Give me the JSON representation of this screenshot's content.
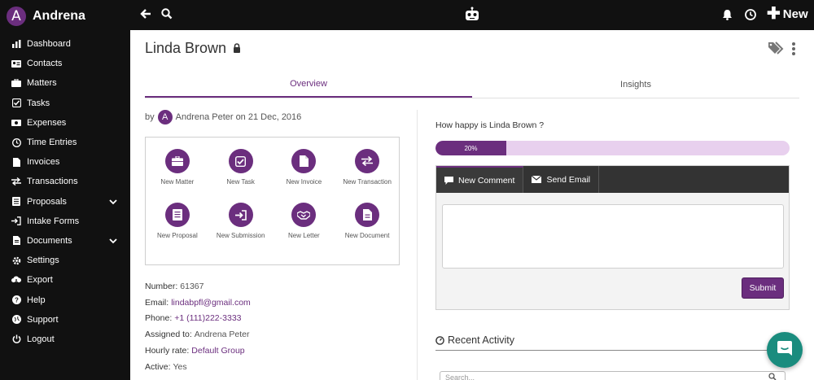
{
  "brand": {
    "initial": "A",
    "name": "Andrena"
  },
  "sidebar": {
    "items": [
      {
        "label": "Dashboard",
        "icon": "bar-chart-icon"
      },
      {
        "label": "Contacts",
        "icon": "id-card-icon"
      },
      {
        "label": "Matters",
        "icon": "briefcase-icon"
      },
      {
        "label": "Tasks",
        "icon": "checkbox-icon"
      },
      {
        "label": "Expenses",
        "icon": "money-icon"
      },
      {
        "label": "Time Entries",
        "icon": "clock-icon"
      },
      {
        "label": "Invoices",
        "icon": "file-icon"
      },
      {
        "label": "Transactions",
        "icon": "exchange-icon"
      },
      {
        "label": "Proposals",
        "icon": "list-icon",
        "has_submenu": true
      },
      {
        "label": "Intake Forms",
        "icon": "sign-in-icon"
      },
      {
        "label": "Documents",
        "icon": "document-icon",
        "has_submenu": true
      },
      {
        "label": "Settings",
        "icon": "gear-icon"
      },
      {
        "label": "Export",
        "icon": "cloud-download-icon"
      },
      {
        "label": "Help",
        "icon": "question-icon"
      },
      {
        "label": "Support",
        "icon": "globe-icon"
      },
      {
        "label": "Logout",
        "icon": "power-icon"
      }
    ]
  },
  "topbar": {
    "new_label": "New"
  },
  "contact": {
    "name": "Linda Brown",
    "tabs": [
      {
        "label": "Overview",
        "active": true
      },
      {
        "label": "Insights",
        "active": false
      }
    ],
    "byline": {
      "prefix": "by",
      "initial": "A",
      "author": "Andrena Peter",
      "on_date": "on 21 Dec, 2016"
    },
    "actions": [
      {
        "label": "New Matter",
        "icon": "briefcase-icon"
      },
      {
        "label": "New Task",
        "icon": "checkbox-icon"
      },
      {
        "label": "New Invoice",
        "icon": "file-icon"
      },
      {
        "label": "New Transaction",
        "icon": "exchange-icon"
      },
      {
        "label": "New Proposal",
        "icon": "list-icon"
      },
      {
        "label": "New Submission",
        "icon": "sign-in-icon"
      },
      {
        "label": "New Letter",
        "icon": "handshake-icon"
      },
      {
        "label": "New Document",
        "icon": "document-icon"
      }
    ],
    "details": [
      {
        "key": "Number:",
        "value": "61367",
        "link": false
      },
      {
        "key": "Email:",
        "value": "lindabpfl@gmail.com",
        "link": true
      },
      {
        "key": "Phone:",
        "value": "+1 (111)222-3333",
        "link": true
      },
      {
        "key": "Assigned to:",
        "value": "Andrena Peter",
        "link": false
      },
      {
        "key": "Hourly rate:",
        "value": "Default Group",
        "link": true
      },
      {
        "key": "Active:",
        "value": "Yes",
        "link": false
      }
    ]
  },
  "happiness": {
    "question": "How happy is Linda Brown ?",
    "percent_label": "20%",
    "fraction": 0.2
  },
  "comment": {
    "tabs": [
      {
        "label": "New Comment",
        "icon": "comment-icon",
        "active": true
      },
      {
        "label": "Send Email",
        "icon": "envelope-icon",
        "active": false
      }
    ],
    "placeholder": "",
    "submit_label": "Submit"
  },
  "recent_activity": {
    "title": "Recent Activity",
    "search_placeholder": "Search..."
  },
  "colors": {
    "accent": "#6b2e7e",
    "sidebar": "#111111",
    "progress_track": "#e8d0ee",
    "chat": "#1a8c7e"
  }
}
